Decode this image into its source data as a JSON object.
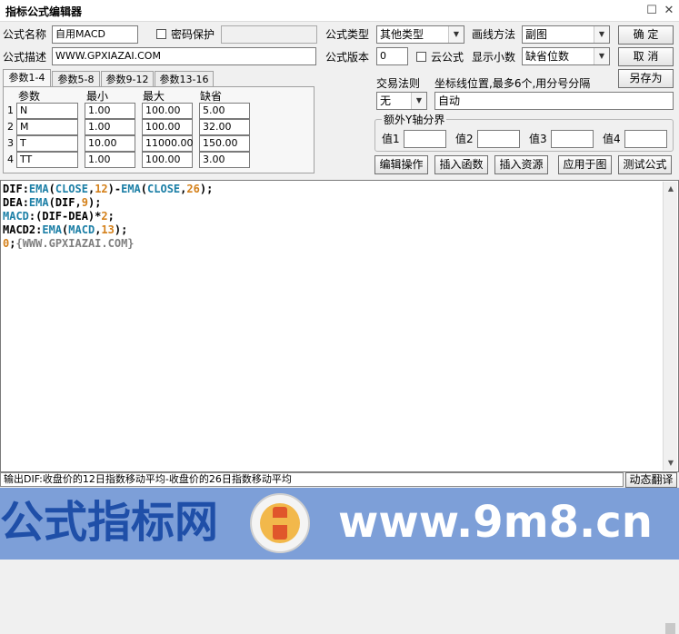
{
  "window": {
    "title": "指标公式编辑器",
    "restore_glyph": "☐",
    "close_glyph": "✕"
  },
  "form": {
    "name_label": "公式名称",
    "name_value": "自用MACD",
    "password_label": "密码保护",
    "desc_label": "公式描述",
    "desc_value": "WWW.GPXIAZAI.COM",
    "type_label": "公式类型",
    "type_value": "其他类型",
    "draw_label": "画线方法",
    "draw_value": "副图",
    "version_label": "公式版本",
    "version_value": "0",
    "cloud_label": "云公式",
    "decimal_label": "显示小数",
    "decimal_value": "缺省位数"
  },
  "buttons": {
    "ok": "确  定",
    "cancel": "取  消",
    "save_as": "另存为",
    "edit_ops": "编辑操作",
    "insert_func": "插入函数",
    "insert_res": "插入资源",
    "apply_chart": "应用于图",
    "test": "测试公式",
    "dynamic_translate": "动态翻译"
  },
  "tabs": [
    "参数1-4",
    "参数5-8",
    "参数9-12",
    "参数13-16"
  ],
  "params": {
    "headers": [
      "参数",
      "最小",
      "最大",
      "缺省"
    ],
    "rows": [
      {
        "num": "1",
        "name": "N",
        "min": "1.00",
        "max": "100.00",
        "def": "5.00"
      },
      {
        "num": "2",
        "name": "M",
        "min": "1.00",
        "max": "100.00",
        "def": "32.00"
      },
      {
        "num": "3",
        "name": "T",
        "min": "10.00",
        "max": "11000.00",
        "def": "150.00"
      },
      {
        "num": "4",
        "name": "TT",
        "min": "1.00",
        "max": "100.00",
        "def": "3.00"
      }
    ]
  },
  "trade": {
    "label": "交易法则",
    "value": "无"
  },
  "coord": {
    "label": "坐标线位置,最多6个,用分号分隔",
    "value": "自动"
  },
  "yaxis": {
    "label": "额外Y轴分界",
    "v1": "值1",
    "v2": "值2",
    "v3": "值3",
    "v4": "值4"
  },
  "code": {
    "lines": [
      [
        {
          "t": "DIF",
          "c": "#000000"
        },
        {
          "t": ":",
          "c": "#000000"
        },
        {
          "t": "EMA",
          "c": "#1c7fa6"
        },
        {
          "t": "(",
          "c": "#000000"
        },
        {
          "t": "CLOSE",
          "c": "#1c7fa6"
        },
        {
          "t": ",",
          "c": "#000000"
        },
        {
          "t": "12",
          "c": "#d4801a"
        },
        {
          "t": ")-",
          "c": "#000000"
        },
        {
          "t": "EMA",
          "c": "#1c7fa6"
        },
        {
          "t": "(",
          "c": "#000000"
        },
        {
          "t": "CLOSE",
          "c": "#1c7fa6"
        },
        {
          "t": ",",
          "c": "#000000"
        },
        {
          "t": "26",
          "c": "#d4801a"
        },
        {
          "t": ");",
          "c": "#000000"
        }
      ],
      [
        {
          "t": "DEA",
          "c": "#000000"
        },
        {
          "t": ":",
          "c": "#000000"
        },
        {
          "t": "EMA",
          "c": "#1c7fa6"
        },
        {
          "t": "(DIF,",
          "c": "#000000"
        },
        {
          "t": "9",
          "c": "#d4801a"
        },
        {
          "t": ");",
          "c": "#000000"
        }
      ],
      [
        {
          "t": "MACD",
          "c": "#1c7fa6"
        },
        {
          "t": ":(DIF-DEA)*",
          "c": "#000000"
        },
        {
          "t": "2",
          "c": "#d4801a"
        },
        {
          "t": ";",
          "c": "#000000"
        }
      ],
      [
        {
          "t": "MACD2",
          "c": "#000000"
        },
        {
          "t": ":",
          "c": "#000000"
        },
        {
          "t": "EMA",
          "c": "#1c7fa6"
        },
        {
          "t": "(",
          "c": "#000000"
        },
        {
          "t": "MACD",
          "c": "#1c7fa6"
        },
        {
          "t": ",",
          "c": "#000000"
        },
        {
          "t": "13",
          "c": "#d4801a"
        },
        {
          "t": ");",
          "c": "#000000"
        }
      ],
      [
        {
          "t": "0",
          "c": "#d4801a"
        },
        {
          "t": ";",
          "c": "#000000"
        },
        {
          "t": "{WWW.GPXIAZAI.COM}",
          "c": "#808080"
        }
      ]
    ]
  },
  "status": {
    "text": "输出DIF:收盘价的12日指数移动平均-收盘价的26日指数移动平均"
  },
  "banner": {
    "left": "公式指标网",
    "right": "www.9m8.cn"
  },
  "colors": {
    "accent": "#1c7fa6",
    "number": "#d4801a",
    "comment": "#808080",
    "banner": "#7d9fd8"
  },
  "icons": {
    "scroll_up": "▲",
    "scroll_down": "▼",
    "dropdown": "▼"
  }
}
